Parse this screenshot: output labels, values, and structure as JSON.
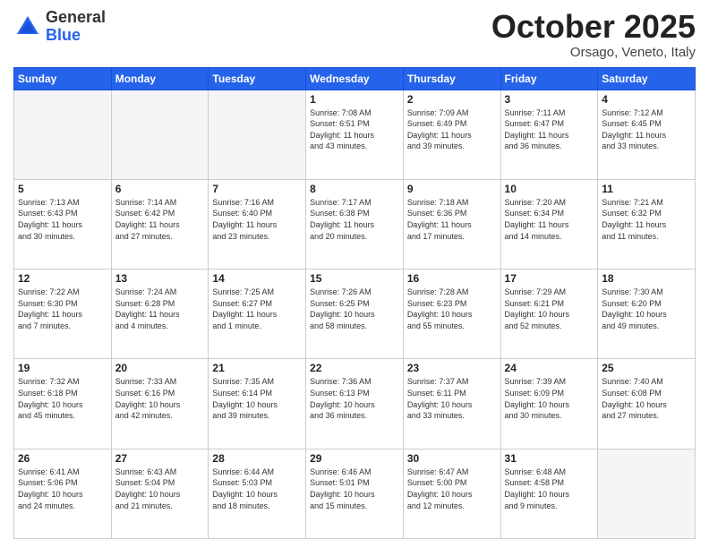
{
  "header": {
    "logo_general": "General",
    "logo_blue": "Blue",
    "month_title": "October 2025",
    "location": "Orsago, Veneto, Italy"
  },
  "days_of_week": [
    "Sunday",
    "Monday",
    "Tuesday",
    "Wednesday",
    "Thursday",
    "Friday",
    "Saturday"
  ],
  "weeks": [
    [
      {
        "day": "",
        "info": ""
      },
      {
        "day": "",
        "info": ""
      },
      {
        "day": "",
        "info": ""
      },
      {
        "day": "1",
        "info": "Sunrise: 7:08 AM\nSunset: 6:51 PM\nDaylight: 11 hours\nand 43 minutes."
      },
      {
        "day": "2",
        "info": "Sunrise: 7:09 AM\nSunset: 6:49 PM\nDaylight: 11 hours\nand 39 minutes."
      },
      {
        "day": "3",
        "info": "Sunrise: 7:11 AM\nSunset: 6:47 PM\nDaylight: 11 hours\nand 36 minutes."
      },
      {
        "day": "4",
        "info": "Sunrise: 7:12 AM\nSunset: 6:45 PM\nDaylight: 11 hours\nand 33 minutes."
      }
    ],
    [
      {
        "day": "5",
        "info": "Sunrise: 7:13 AM\nSunset: 6:43 PM\nDaylight: 11 hours\nand 30 minutes."
      },
      {
        "day": "6",
        "info": "Sunrise: 7:14 AM\nSunset: 6:42 PM\nDaylight: 11 hours\nand 27 minutes."
      },
      {
        "day": "7",
        "info": "Sunrise: 7:16 AM\nSunset: 6:40 PM\nDaylight: 11 hours\nand 23 minutes."
      },
      {
        "day": "8",
        "info": "Sunrise: 7:17 AM\nSunset: 6:38 PM\nDaylight: 11 hours\nand 20 minutes."
      },
      {
        "day": "9",
        "info": "Sunrise: 7:18 AM\nSunset: 6:36 PM\nDaylight: 11 hours\nand 17 minutes."
      },
      {
        "day": "10",
        "info": "Sunrise: 7:20 AM\nSunset: 6:34 PM\nDaylight: 11 hours\nand 14 minutes."
      },
      {
        "day": "11",
        "info": "Sunrise: 7:21 AM\nSunset: 6:32 PM\nDaylight: 11 hours\nand 11 minutes."
      }
    ],
    [
      {
        "day": "12",
        "info": "Sunrise: 7:22 AM\nSunset: 6:30 PM\nDaylight: 11 hours\nand 7 minutes."
      },
      {
        "day": "13",
        "info": "Sunrise: 7:24 AM\nSunset: 6:28 PM\nDaylight: 11 hours\nand 4 minutes."
      },
      {
        "day": "14",
        "info": "Sunrise: 7:25 AM\nSunset: 6:27 PM\nDaylight: 11 hours\nand 1 minute."
      },
      {
        "day": "15",
        "info": "Sunrise: 7:26 AM\nSunset: 6:25 PM\nDaylight: 10 hours\nand 58 minutes."
      },
      {
        "day": "16",
        "info": "Sunrise: 7:28 AM\nSunset: 6:23 PM\nDaylight: 10 hours\nand 55 minutes."
      },
      {
        "day": "17",
        "info": "Sunrise: 7:29 AM\nSunset: 6:21 PM\nDaylight: 10 hours\nand 52 minutes."
      },
      {
        "day": "18",
        "info": "Sunrise: 7:30 AM\nSunset: 6:20 PM\nDaylight: 10 hours\nand 49 minutes."
      }
    ],
    [
      {
        "day": "19",
        "info": "Sunrise: 7:32 AM\nSunset: 6:18 PM\nDaylight: 10 hours\nand 45 minutes."
      },
      {
        "day": "20",
        "info": "Sunrise: 7:33 AM\nSunset: 6:16 PM\nDaylight: 10 hours\nand 42 minutes."
      },
      {
        "day": "21",
        "info": "Sunrise: 7:35 AM\nSunset: 6:14 PM\nDaylight: 10 hours\nand 39 minutes."
      },
      {
        "day": "22",
        "info": "Sunrise: 7:36 AM\nSunset: 6:13 PM\nDaylight: 10 hours\nand 36 minutes."
      },
      {
        "day": "23",
        "info": "Sunrise: 7:37 AM\nSunset: 6:11 PM\nDaylight: 10 hours\nand 33 minutes."
      },
      {
        "day": "24",
        "info": "Sunrise: 7:39 AM\nSunset: 6:09 PM\nDaylight: 10 hours\nand 30 minutes."
      },
      {
        "day": "25",
        "info": "Sunrise: 7:40 AM\nSunset: 6:08 PM\nDaylight: 10 hours\nand 27 minutes."
      }
    ],
    [
      {
        "day": "26",
        "info": "Sunrise: 6:41 AM\nSunset: 5:06 PM\nDaylight: 10 hours\nand 24 minutes."
      },
      {
        "day": "27",
        "info": "Sunrise: 6:43 AM\nSunset: 5:04 PM\nDaylight: 10 hours\nand 21 minutes."
      },
      {
        "day": "28",
        "info": "Sunrise: 6:44 AM\nSunset: 5:03 PM\nDaylight: 10 hours\nand 18 minutes."
      },
      {
        "day": "29",
        "info": "Sunrise: 6:46 AM\nSunset: 5:01 PM\nDaylight: 10 hours\nand 15 minutes."
      },
      {
        "day": "30",
        "info": "Sunrise: 6:47 AM\nSunset: 5:00 PM\nDaylight: 10 hours\nand 12 minutes."
      },
      {
        "day": "31",
        "info": "Sunrise: 6:48 AM\nSunset: 4:58 PM\nDaylight: 10 hours\nand 9 minutes."
      },
      {
        "day": "",
        "info": ""
      }
    ]
  ]
}
